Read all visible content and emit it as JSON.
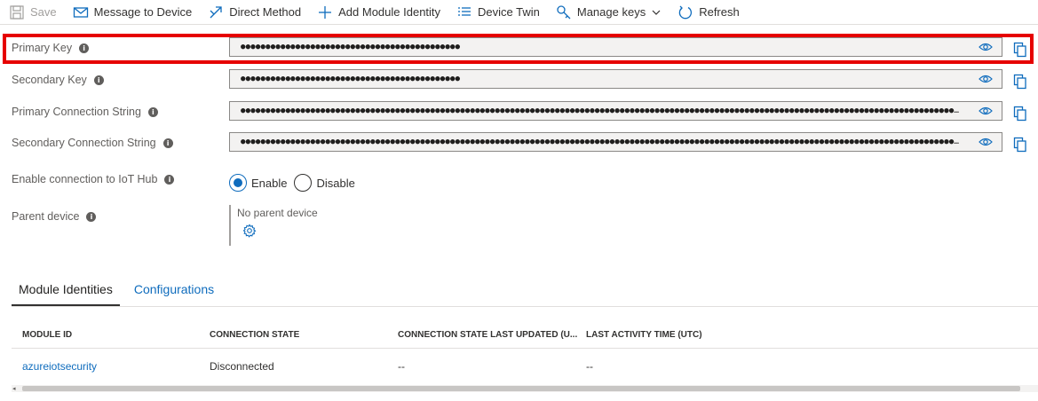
{
  "toolbar": {
    "save": "Save",
    "message_to_device": "Message to Device",
    "direct_method": "Direct Method",
    "add_module_identity": "Add Module Identity",
    "device_twin": "Device Twin",
    "manage_keys": "Manage keys",
    "refresh": "Refresh"
  },
  "fields": {
    "primary_key": {
      "label": "Primary Key",
      "value": "●●●●●●●●●●●●●●●●●●●●●●●●●●●●●●●●●●●●●●●●●●●●"
    },
    "secondary_key": {
      "label": "Secondary Key",
      "value": "●●●●●●●●●●●●●●●●●●●●●●●●●●●●●●●●●●●●●●●●●●●●"
    },
    "primary_connection_string": {
      "label": "Primary Connection String",
      "value": "●●●●●●●●●●●●●●●●●●●●●●●●●●●●●●●●●●●●●●●●●●●●●●●●●●●●●●●●●●●●●●●●●●●●●●●●●●●●●●●●●●●●●●●●●●●●●●●●●●●●●●●●●●●●●●●●●●●●●●●●●●●●●●●●●●●●●●●●●●●●●●●…"
    },
    "secondary_connection_string": {
      "label": "Secondary Connection String",
      "value": "●●●●●●●●●●●●●●●●●●●●●●●●●●●●●●●●●●●●●●●●●●●●●●●●●●●●●●●●●●●●●●●●●●●●●●●●●●●●●●●●●●●●●●●●●●●●●●●●●●●●●●●●●●●●●●●●●●●●●●●●●●●●●●●●●●●●●●●●●●●●●●●…"
    }
  },
  "connection": {
    "label": "Enable connection to IoT Hub",
    "enable": "Enable",
    "disable": "Disable",
    "selected": "Enable"
  },
  "parent": {
    "label": "Parent device",
    "value": "No parent device"
  },
  "tabs": {
    "module_identities": "Module Identities",
    "configurations": "Configurations"
  },
  "table": {
    "headers": [
      "MODULE ID",
      "CONNECTION STATE",
      "CONNECTION STATE LAST UPDATED (U...",
      "LAST ACTIVITY TIME (UTC)"
    ],
    "rows": [
      [
        "azureiotsecurity",
        "Disconnected",
        "--",
        "--"
      ]
    ]
  },
  "colors": {
    "accent": "#0f6cbd",
    "highlight": "#e60000"
  }
}
